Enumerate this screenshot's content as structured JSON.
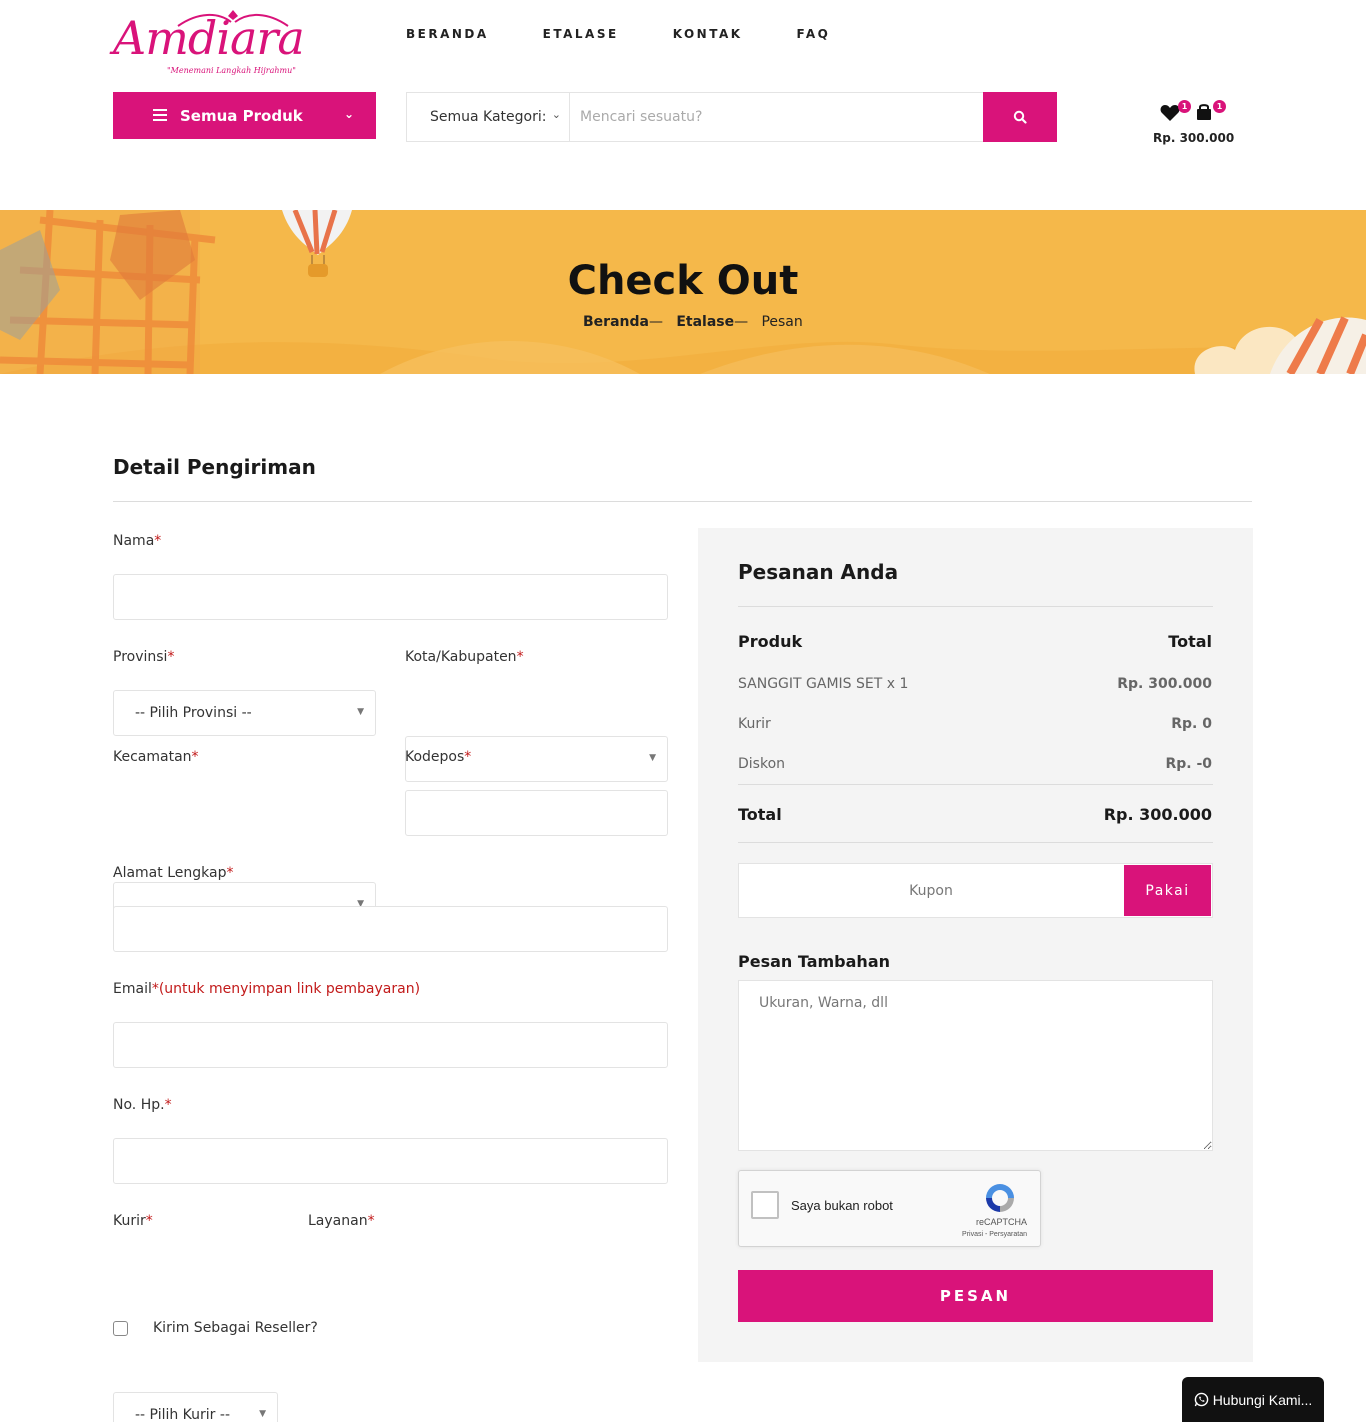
{
  "brand": {
    "name": "Amdiara",
    "tagline": "\"Menemani Langkah Hijrahmu\"",
    "color": "#d9137a"
  },
  "nav": {
    "items": [
      "BERANDA",
      "ETALASE",
      "KONTAK",
      "FAQ"
    ]
  },
  "toolbar": {
    "all_products": "Semua Produk",
    "category_select": "Semua Kategori:",
    "search_placeholder": "Mencari sesuatu?",
    "cart_total": "Rp. 300.000",
    "wishlist_count": "1",
    "cart_count": "1"
  },
  "banner": {
    "title": "Check Out",
    "breadcrumb": {
      "home": "Beranda",
      "sep": "—",
      "shop": "Etalase",
      "current": "Pesan"
    }
  },
  "form": {
    "title": "Detail Pengiriman",
    "req": "*",
    "name_label": "Nama",
    "province_label": "Provinsi",
    "province_value": "-- Pilih Provinsi --",
    "city_label": "Kota/Kabupaten",
    "district_label": "Kecamatan",
    "postal_label": "Kodepos",
    "address_label": "Alamat Lengkap",
    "email_label": "Email",
    "email_note": "(untuk menyimpan link pembayaran)",
    "phone_label": "No. Hp.",
    "courier_label": "Kurir",
    "courier_value": "-- Pilih Kurir --",
    "service_label": "Layanan",
    "reseller_label": "Kirim Sebagai Reseller?"
  },
  "order": {
    "title": "Pesanan Anda",
    "col_product": "Produk",
    "col_total": "Total",
    "rows": [
      {
        "label": "SANGGIT GAMIS SET x 1",
        "value": "Rp. 300.000"
      },
      {
        "label": "Kurir",
        "value": "Rp. 0"
      },
      {
        "label": "Diskon",
        "value": "Rp. -0"
      }
    ],
    "total_label": "Total",
    "total_value": "Rp. 300.000",
    "coupon_placeholder": "Kupon",
    "coupon_button": "Pakai",
    "notes_label": "Pesan Tambahan",
    "notes_placeholder": "Ukuran, Warna, dll",
    "recaptcha_label": "Saya bukan robot",
    "recaptcha_brand": "reCAPTCHA",
    "recaptcha_links": "Privasi - Persyaratan",
    "submit": "PESAN"
  },
  "whatsapp": {
    "label": "Hubungi Kami..."
  }
}
